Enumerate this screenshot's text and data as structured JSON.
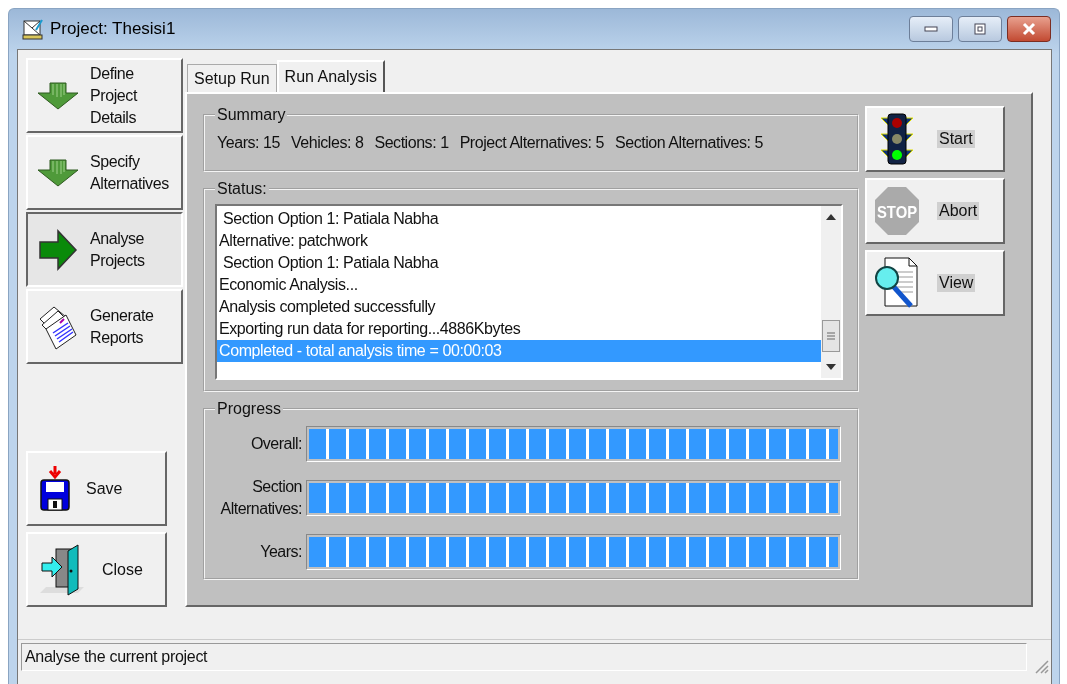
{
  "window": {
    "title": "Project: Thesisi1"
  },
  "sidebar": {
    "items": [
      {
        "kind": "down-arrow",
        "label": "Define Project Details",
        "selected": false
      },
      {
        "kind": "down-arrow",
        "label": "Specify Alternatives",
        "selected": false
      },
      {
        "kind": "right-arrow",
        "label": "Analyse Projects",
        "selected": true
      },
      {
        "kind": "reports",
        "label": "Generate Reports",
        "selected": false
      }
    ],
    "actions": [
      {
        "kind": "save",
        "label": "Save"
      },
      {
        "kind": "close",
        "label": "Close"
      }
    ]
  },
  "tabs": [
    {
      "label": "Setup Run",
      "selected": false
    },
    {
      "label": "Run Analysis",
      "selected": true
    }
  ],
  "summary": {
    "title": "Summary",
    "items": [
      "Years: 15",
      "Vehicles: 8",
      "Sections: 1",
      "Project Alternatives: 5",
      "Section Alternatives: 5"
    ]
  },
  "status": {
    "title": "Status:",
    "lines": [
      {
        "text": " Section Option 1: Patiala Nabha",
        "selected": false
      },
      {
        "text": "Alternative: patchwork",
        "selected": false
      },
      {
        "text": " Section Option 1: Patiala Nabha",
        "selected": false
      },
      {
        "text": "Economic Analysis...",
        "selected": false
      },
      {
        "text": "Analysis completed successfully",
        "selected": false
      },
      {
        "text": "Exporting run data for reporting...4886Kbytes",
        "selected": false
      },
      {
        "text": "Completed - total analysis time = 00:00:03",
        "selected": true
      }
    ]
  },
  "progress": {
    "title": "Progress",
    "bars": [
      {
        "label": "Overall:",
        "level": 1
      },
      {
        "label": "Section Alternatives:",
        "level": 1
      },
      {
        "label": "Years:",
        "level": 1
      }
    ]
  },
  "run_buttons": [
    {
      "kind": "start",
      "label": "Start"
    },
    {
      "kind": "abort",
      "label": "Abort",
      "icon_text": "STOP"
    },
    {
      "kind": "view",
      "label": "View"
    }
  ],
  "status_bar": {
    "text": "Analyse the current project"
  }
}
